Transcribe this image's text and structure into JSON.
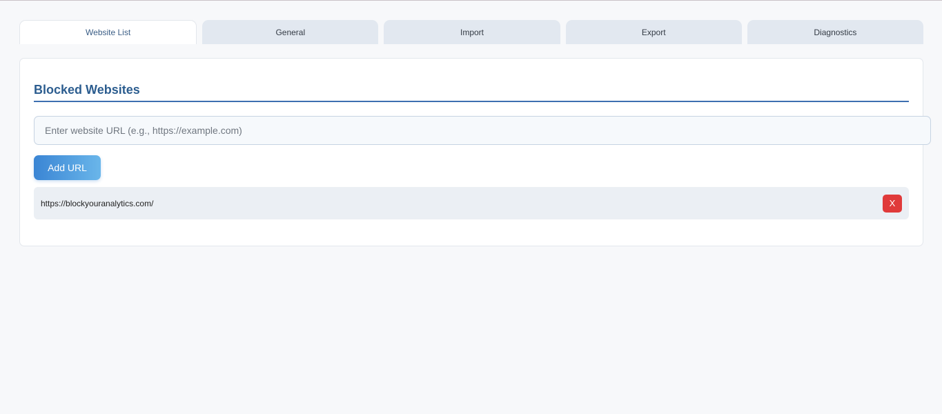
{
  "tabs": [
    {
      "label": "Website List",
      "active": true
    },
    {
      "label": "General",
      "active": false
    },
    {
      "label": "Import",
      "active": false
    },
    {
      "label": "Export",
      "active": false
    },
    {
      "label": "Diagnostics",
      "active": false
    }
  ],
  "panel": {
    "title": "Blocked Websites",
    "input": {
      "placeholder": "Enter website URL (e.g., https://example.com)",
      "value": ""
    },
    "add_button_label": "Add URL",
    "blocked_urls": [
      {
        "url": "https://blockyouranalytics.com/",
        "remove_label": "X"
      }
    ]
  },
  "colors": {
    "accent": "#2c5d8f",
    "title_rule": "#3d6fb0",
    "add_button_start": "#3a85d4",
    "add_button_end": "#6ab6ea",
    "remove_button": "#e03a3a",
    "background": "#f7f8fa"
  }
}
